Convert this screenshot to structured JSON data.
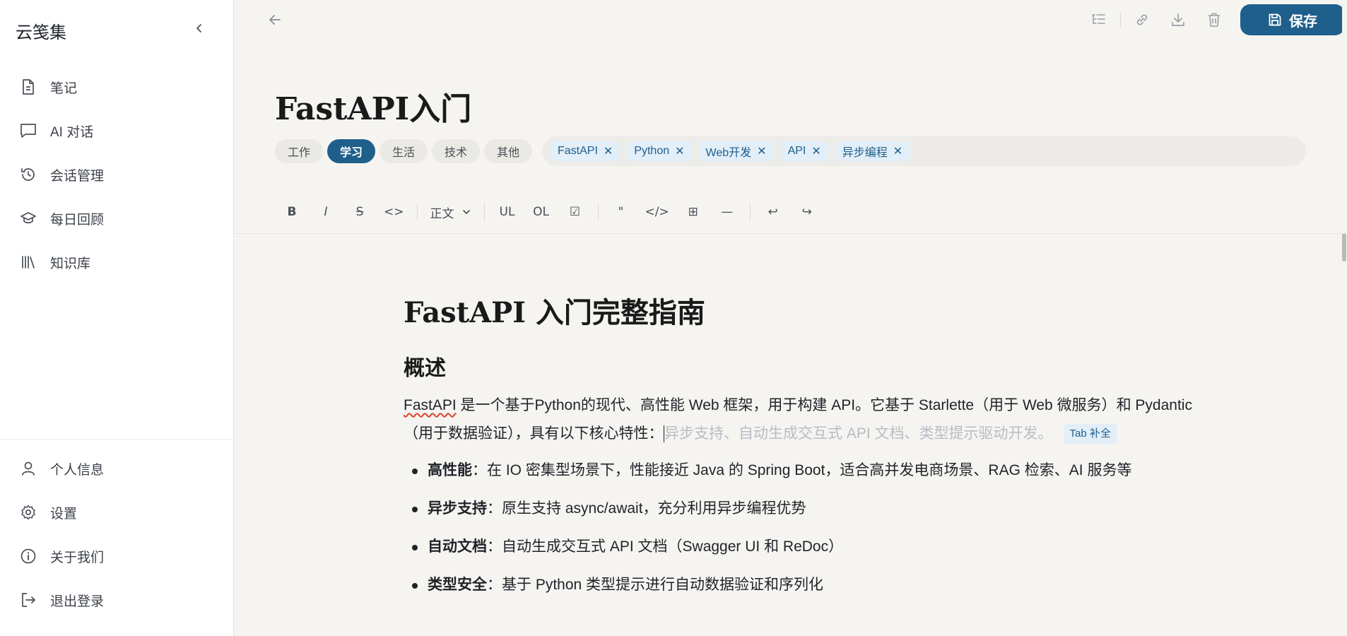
{
  "app": {
    "brand": "云笺集"
  },
  "sidebar": {
    "items": [
      {
        "label": "笔记",
        "icon": "note-icon"
      },
      {
        "label": "AI 对话",
        "icon": "chat-icon"
      },
      {
        "label": "会话管理",
        "icon": "history-icon"
      },
      {
        "label": "每日回顾",
        "icon": "graduation-cap-icon"
      },
      {
        "label": "知识库",
        "icon": "library-icon"
      }
    ],
    "bottom_items": [
      {
        "label": "个人信息",
        "icon": "user-icon"
      },
      {
        "label": "设置",
        "icon": "gear-icon"
      },
      {
        "label": "关于我们",
        "icon": "info-icon"
      },
      {
        "label": "退出登录",
        "icon": "logout-icon"
      }
    ]
  },
  "toolbar": {
    "save_label": "保存"
  },
  "note": {
    "title": "FastAPI入门",
    "categories": [
      "工作",
      "学习",
      "生活",
      "技术",
      "其他"
    ],
    "active_category": "学习",
    "tags": [
      "FastAPI",
      "Python",
      "Web开发",
      "API",
      "异步编程"
    ]
  },
  "format_toolbar": {
    "bold": "B",
    "italic": "I",
    "strike": "S",
    "inline_code": "<>",
    "heading_select": "正文",
    "ul": "UL",
    "ol": "OL",
    "task": "☑",
    "quote": "\"",
    "code_block": "</>",
    "table": "⊞",
    "hr": "—",
    "undo": "↩",
    "redo": "↪"
  },
  "content": {
    "h1": "FastAPI 入门完整指南",
    "h2": "概述",
    "para_lead": "FastAPI",
    "para_rest": " 是一个基于Python的现代、高性能 Web 框架，用于构建 API。它基于 Starlette（用于 Web 微服务）和 Pydantic（用于数据验证），具有以下核心特性：",
    "suggestion": "异步支持、自动生成交互式 API 文档、类型提示驱动开发。",
    "tab_hint": "Tab 补全",
    "bullets": [
      {
        "bold": "高性能",
        "text": "：在 IO 密集型场景下，性能接近 Java 的 Spring Boot，适合高并发电商场景、RAG 检索、AI 服务等"
      },
      {
        "bold": "异步支持",
        "text": "：原生支持 async/await，充分利用异步编程优势"
      },
      {
        "bold": "自动文档",
        "text": "：自动生成交互式 API 文档（Swagger UI 和 ReDoc）"
      },
      {
        "bold": "类型安全",
        "text": "：基于 Python 类型提示进行自动数据验证和序列化"
      }
    ]
  },
  "colors": {
    "accent": "#1f5f8b",
    "tag_bg": "#e2eef8",
    "page_bg": "#f5f4f1"
  }
}
